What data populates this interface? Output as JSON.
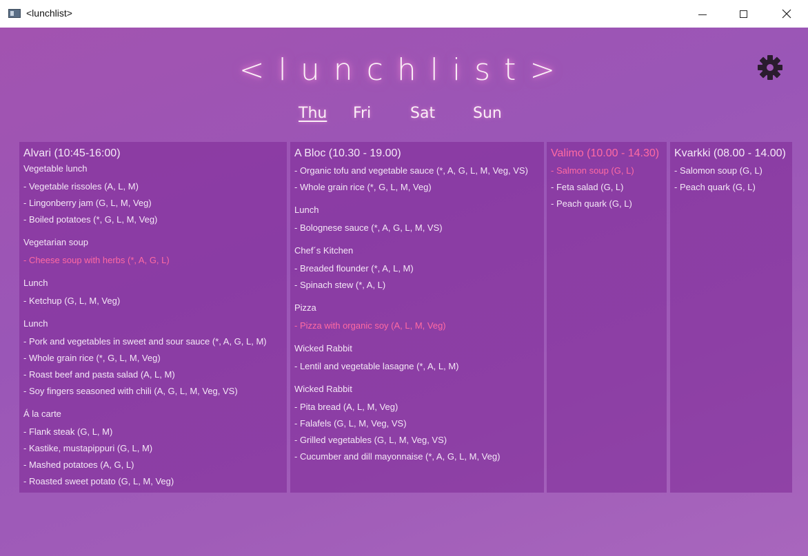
{
  "window": {
    "title": "<lunchlist>",
    "min_symbol": "",
    "max_symbol": "",
    "close_symbol": "✕"
  },
  "logo": "<lunchlist>",
  "settings_icon": "gear-icon",
  "days": [
    {
      "label": "Thu",
      "active": true
    },
    {
      "label": "Fri",
      "active": false
    },
    {
      "label": "Sat",
      "active": false
    },
    {
      "label": "Sun",
      "active": false
    }
  ],
  "colors": {
    "background": "#9f57b6",
    "highlight": "#ff6aa3",
    "panel": "#7d2896",
    "text": "#f5e8f7"
  },
  "restaurants": [
    {
      "name": "Alvari (10:45-16:00)",
      "highlight": false,
      "groups": [
        {
          "title": "Vegetable lunch",
          "items": [
            {
              "text": "- Vegetable rissoles (A, L, M)",
              "highlight": false
            },
            {
              "text": "- Lingonberry jam (G, L, M, Veg)",
              "highlight": false
            },
            {
              "text": "- Boiled potatoes (*, G, L, M, Veg)",
              "highlight": false
            }
          ]
        },
        {
          "title": "Vegetarian soup",
          "items": [
            {
              "text": "- Cheese soup with herbs (*, A, G, L)",
              "highlight": true
            }
          ]
        },
        {
          "title": "Lunch",
          "items": [
            {
              "text": "- Ketchup (G, L, M, Veg)",
              "highlight": false
            }
          ]
        },
        {
          "title": "Lunch",
          "items": [
            {
              "text": "- Pork and vegetables in sweet and sour sauce (*, A, G, L, M)",
              "highlight": false
            },
            {
              "text": "- Whole grain rice (*, G, L, M, Veg)",
              "highlight": false
            },
            {
              "text": "- Roast beef and pasta salad (A, L, M)",
              "highlight": false
            },
            {
              "text": "- Soy fingers seasoned with chili (A, G, L, M, Veg, VS)",
              "highlight": false
            }
          ]
        },
        {
          "title": "Á la carte",
          "items": [
            {
              "text": "- Flank steak (G, L, M)",
              "highlight": false
            },
            {
              "text": "- Kastike, mustapippuri (G, L, M)",
              "highlight": false
            },
            {
              "text": "- Mashed potatoes (A, G, L)",
              "highlight": false
            },
            {
              "text": "- Roasted sweet potato (G, L, M, Veg)",
              "highlight": false
            }
          ]
        }
      ]
    },
    {
      "name": "A Bloc (10.30 - 19.00)",
      "highlight": false,
      "groups": [
        {
          "title": "",
          "items": [
            {
              "text": "- Organic tofu and vegetable sauce (*, A, G, L, M, Veg, VS)",
              "highlight": false
            },
            {
              "text": "- Whole grain rice (*, G, L, M, Veg)",
              "highlight": false
            }
          ]
        },
        {
          "title": "Lunch",
          "items": [
            {
              "text": "- Bolognese sauce (*, A, G, L, M, VS)",
              "highlight": false
            }
          ]
        },
        {
          "title": "Chef´s Kitchen",
          "items": [
            {
              "text": "- Breaded flounder (*, A, L, M)",
              "highlight": false
            },
            {
              "text": "- Spinach stew (*, A, L)",
              "highlight": false
            }
          ]
        },
        {
          "title": "Pizza",
          "items": [
            {
              "text": "- Pizza with organic soy (A, L, M, Veg)",
              "highlight": true
            }
          ]
        },
        {
          "title": "Wicked Rabbit",
          "items": [
            {
              "text": "- Lentil and vegetable lasagne (*, A, L, M)",
              "highlight": false
            }
          ]
        },
        {
          "title": "Wicked Rabbit",
          "items": [
            {
              "text": "- Pita bread (A, L, M, Veg)",
              "highlight": false
            },
            {
              "text": "- Falafels (G, L, M, Veg, VS)",
              "highlight": false
            },
            {
              "text": "- Grilled vegetables (G, L, M, Veg, VS)",
              "highlight": false
            },
            {
              "text": "- Cucumber and dill mayonnaise (*, A, G, L, M, Veg)",
              "highlight": false
            }
          ]
        }
      ]
    },
    {
      "name": "Valimo (10.00 - 14.30)",
      "highlight": true,
      "groups": [
        {
          "title": "",
          "items": [
            {
              "text": "- Salmon soup (G, L)",
              "highlight": true
            },
            {
              "text": "- Feta salad (G, L)",
              "highlight": false
            },
            {
              "text": "- Peach quark (G, L)",
              "highlight": false
            }
          ]
        }
      ]
    },
    {
      "name": "Kvarkki (08.00 - 14.00)",
      "highlight": false,
      "groups": [
        {
          "title": "",
          "items": [
            {
              "text": "- Salomon soup (G, L)",
              "highlight": false
            },
            {
              "text": "- Peach quark (G, L)",
              "highlight": false
            }
          ]
        }
      ]
    }
  ]
}
